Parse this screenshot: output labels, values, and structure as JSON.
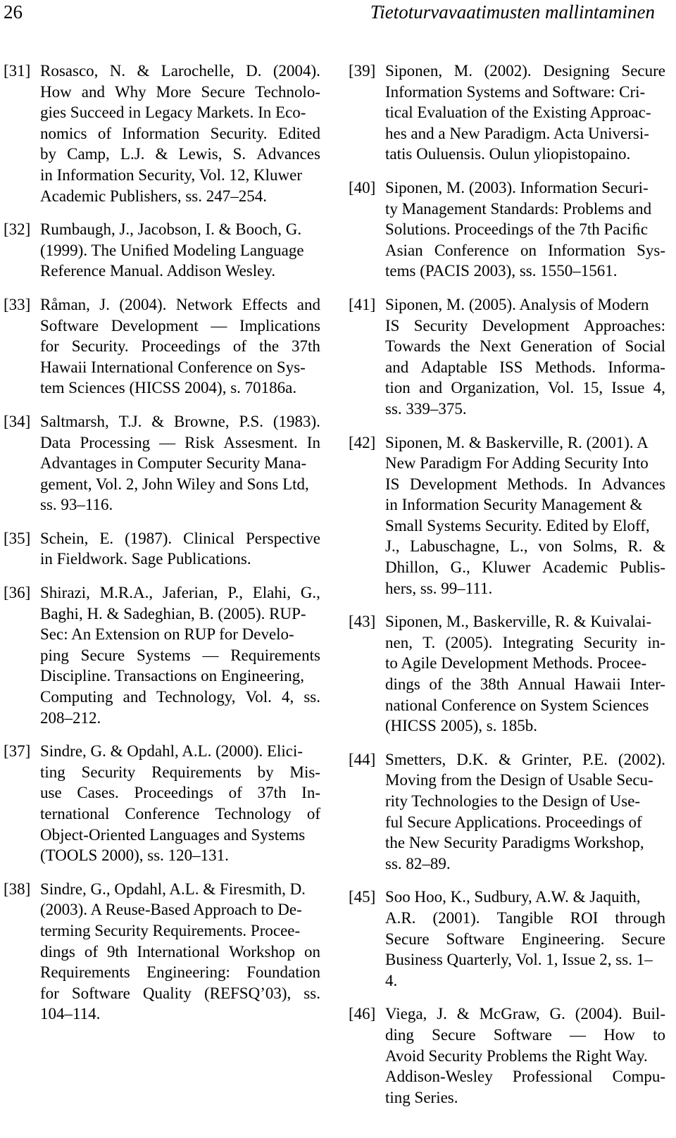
{
  "page": {
    "folio": "26",
    "running_title": "Tietoturvavaatimusten mallintaminen"
  },
  "columns": {
    "left": [
      {
        "label": "[31]",
        "text": "Rosasco, N. & Larochelle, D. (2004). How and Why More Secure Technologies Succeed in Legacy Markets. In Economics of Information Security. Edited by Camp, L.J. & Lewis, S. Advances in Information Security, Vol. 12, Kluwer Academic Publishers, ss. 247–254.",
        "lines": [
          [
            "Rosasco,",
            "N.",
            "&",
            "Larochelle,",
            "D.",
            "(2004)."
          ],
          [
            "How",
            "and",
            "Why",
            "More",
            "Secure",
            "Technolo-"
          ],
          [
            "gies Succeed in Legacy Markets. In Eco-"
          ],
          [
            "nomics",
            "of",
            "Information",
            "Security.",
            "Edited"
          ],
          [
            "by",
            "Camp,",
            "L.J.",
            "&",
            "Lewis,",
            "S.",
            "Advances"
          ],
          [
            "in Information Security, Vol. 12, Kluwer"
          ],
          [
            "Academic Publishers, ss. 247–254."
          ]
        ]
      },
      {
        "label": "[32]",
        "text": "Rumbaugh, J., Jacobson, I. & Booch, G. (1999). The Unified Modeling Language Reference Manual. Addison Wesley.",
        "lines": [
          [
            "Rumbaugh, J., Jacobson, I. & Booch, G."
          ],
          [
            "(1999). The Uniﬁed Modeling Language"
          ],
          [
            "Reference Manual. Addison Wesley."
          ]
        ]
      },
      {
        "label": "[33]",
        "text": "Råman, J. (2004). Network Effects and Software Development — Implications for Security. Proceedings of the 37th Hawaii International Conference on System Sciences (HICSS 2004), s. 70186a.",
        "lines": [
          [
            "Råman,",
            "J.",
            "(2004).",
            "Network",
            "Effects",
            "and"
          ],
          [
            "Software",
            "Development",
            "—",
            "Implications"
          ],
          [
            "for",
            "Security.",
            "Proceedings",
            "of",
            "the",
            "37th"
          ],
          [
            "Hawaii International Conference on Sys-"
          ],
          [
            "tem Sciences (HICSS 2004), s. 70186a."
          ]
        ]
      },
      {
        "label": "[34]",
        "text": "Saltmarsh, T.J. & Browne, P.S. (1983). Data Processing — Risk Assesment. In Advantages in Computer Security Management, Vol. 2, John Wiley and Sons Ltd, ss. 93–116.",
        "lines": [
          [
            "Saltmarsh,",
            "T.J.",
            "&",
            "Browne,",
            "P.S.",
            "(1983)."
          ],
          [
            "Data",
            "Processing",
            "—",
            "Risk",
            "Assesment.",
            "In"
          ],
          [
            "Advantages in Computer Security Mana-"
          ],
          [
            "gement, Vol. 2, John Wiley and Sons Ltd,"
          ],
          [
            "ss. 93–116."
          ]
        ]
      },
      {
        "label": "[35]",
        "text": "Schein, E. (1987). Clinical Perspective in Fieldwork. Sage Publications.",
        "lines": [
          [
            "Schein,",
            "E.",
            "(1987).",
            "Clinical",
            "Perspective"
          ],
          [
            "in Fieldwork. Sage Publications."
          ]
        ]
      },
      {
        "label": "[36]",
        "text": "Shirazi, M.R.A., Jaferian, P., Elahi, G., Baghi, H. & Sadeghian, B. (2005). RUPSec: An Extension on RUP for Developing Secure Systems — Requirements Discipline. Transactions on Engineering, Computing and Technology, Vol. 4, ss. 208–212.",
        "lines": [
          [
            "Shirazi,",
            "M.R.A.,",
            "Jaferian,",
            "P.,",
            "Elahi,",
            "G.,"
          ],
          [
            "Baghi, H. & Sadeghian, B. (2005). RUP-"
          ],
          [
            "Sec: An Extension on RUP for Develo-"
          ],
          [
            "ping",
            "Secure",
            "Systems",
            "—",
            "Requirements"
          ],
          [
            "Discipline. Transactions on Engineering,"
          ],
          [
            "Computing",
            "and",
            "Technology,",
            "Vol.",
            "4,",
            "ss."
          ],
          [
            "208–212."
          ]
        ]
      },
      {
        "label": "[37]",
        "text": "Sindre, G. & Opdahl, A.L. (2000). Eliciting Security Requirements by Misuse Cases. Proceedings of 37th International Conference Technology of Object-Oriented Languages and Systems (TOOLS 2000), ss. 120–131.",
        "lines": [
          [
            "Sindre, G. & Opdahl, A.L. (2000). Elici-"
          ],
          [
            "ting",
            "Security",
            "Requirements",
            "by",
            "Mis-"
          ],
          [
            "use",
            "Cases.",
            "Proceedings",
            "of",
            "37th",
            "In-"
          ],
          [
            "ternational",
            "Conference",
            "Technology",
            "of"
          ],
          [
            "Object-Oriented Languages and Systems"
          ],
          [
            "(TOOLS 2000), ss. 120–131."
          ]
        ]
      },
      {
        "label": "[38]",
        "text": "Sindre, G., Opdahl, A.L. & Firesmith, D. (2003). A Reuse-Based Approach to Determing Security Requirements. Proceedings of 9th International Workshop on Requirements Engineering: Foundation for Software Quality (REFSQ’03), ss. 104–114.",
        "lines": [
          [
            "Sindre, G., Opdahl, A.L. & Firesmith, D."
          ],
          [
            "(2003). A Reuse-Based Approach to De-"
          ],
          [
            "terming Security Requirements. Procee-"
          ],
          [
            "dings",
            "of",
            "9th",
            "International",
            "Workshop",
            "on"
          ],
          [
            "Requirements",
            "Engineering:",
            "Foundation"
          ],
          [
            "for",
            "Software",
            "Quality",
            "(REFSQ’03),",
            "ss."
          ],
          [
            "104–114."
          ]
        ]
      }
    ],
    "right": [
      {
        "label": "[39]",
        "text": "Siponen, M. (2002). Designing Secure Information Systems and Software: Critical Evaluation of the Existing Approaches and a New Paradigm. Acta Universitatis Ouluensis. Oulun yliopistopaino.",
        "lines": [
          [
            "Siponen,",
            "M.",
            "(2002).",
            "Designing",
            "Secure"
          ],
          [
            "Information Systems and Software: Cri-"
          ],
          [
            "tical Evaluation of the Existing Approac-"
          ],
          [
            "hes and a New Paradigm. Acta Universi-"
          ],
          [
            "tatis Ouluensis. Oulun yliopistopaino."
          ]
        ]
      },
      {
        "label": "[40]",
        "text": "Siponen, M. (2003). Information Security Management Standards: Problems and Solutions. Proceedings of the 7th Pacific Asian Conference on Information Systems (PACIS 2003), ss. 1550–1561.",
        "lines": [
          [
            "Siponen, M. (2003). Information Securi-"
          ],
          [
            "ty Management Standards: Problems and"
          ],
          [
            "Solutions. Proceedings of the 7th Paciﬁc"
          ],
          [
            "Asian",
            "Conference",
            "on",
            "Information",
            "Sys-"
          ],
          [
            "tems (PACIS 2003), ss. 1550–1561."
          ]
        ]
      },
      {
        "label": "[41]",
        "text": "Siponen, M. (2005). Analysis of Modern IS Security Development Approaches: Towards the Next Generation of Social and Adaptable ISS Methods. Information and Organization, Vol. 15, Issue 4, ss. 339–375.",
        "lines": [
          [
            "Siponen, M. (2005). Analysis of Modern"
          ],
          [
            "IS",
            "Security",
            "Development",
            "Approaches:"
          ],
          [
            "Towards",
            "the",
            "Next",
            "Generation",
            "of",
            "Social"
          ],
          [
            "and",
            "Adaptable",
            "ISS",
            "Methods.",
            "Informa-"
          ],
          [
            "tion",
            "and",
            "Organization,",
            "Vol.",
            "15,",
            "Issue",
            "4,"
          ],
          [
            "ss. 339–375."
          ]
        ]
      },
      {
        "label": "[42]",
        "text": "Siponen, M. & Baskerville, R. (2001). A New Paradigm For Adding Security Into IS Development Methods. In Advances in Information Security Management & Small Systems Security. Edited by Eloff, J., Labuschagne, L., von Solms, R. & Dhillon, G., Kluwer Academic Publishers, ss. 99–111.",
        "lines": [
          [
            "Siponen, M. & Baskerville, R. (2001). A"
          ],
          [
            "New Paradigm For Adding Security Into"
          ],
          [
            "IS",
            "Development",
            "Methods.",
            "In",
            "Advances"
          ],
          [
            "in Information Security Management &"
          ],
          [
            "Small Systems Security. Edited by Eloff,"
          ],
          [
            "J.,",
            "Labuschagne,",
            "L.,",
            "von",
            "Solms,",
            "R.",
            "&"
          ],
          [
            "Dhillon,",
            "G.,",
            "Kluwer",
            "Academic",
            "Publis-"
          ],
          [
            "hers, ss. 99–111."
          ]
        ]
      },
      {
        "label": "[43]",
        "text": "Siponen, M., Baskerville, R. & Kuivalainen, T. (2005). Integrating Security into Agile Development Methods. Proceedings of the 38th Annual Hawaii International Conference on System Sciences (HICSS 2005), s. 185b.",
        "lines": [
          [
            "Siponen, M., Baskerville, R. & Kuivalai-"
          ],
          [
            "nen,",
            "T.",
            "(2005).",
            "Integrating",
            "Security",
            "in-"
          ],
          [
            "to Agile Development Methods. Procee-"
          ],
          [
            "dings",
            "of",
            "the",
            "38th",
            "Annual",
            "Hawaii",
            "Inter-"
          ],
          [
            "national Conference on System Sciences"
          ],
          [
            "(HICSS 2005), s. 185b."
          ]
        ]
      },
      {
        "label": "[44]",
        "text": "Smetters, D.K. & Grinter, P.E. (2002). Moving from the Design of Usable Security Technologies to the Design of Useful Secure Applications. Proceedings of the New Security Paradigms Workshop, ss. 82–89.",
        "lines": [
          [
            "Smetters,",
            "D.K.",
            "&",
            "Grinter,",
            "P.E.",
            "(2002)."
          ],
          [
            "Moving from the Design of Usable Secu-"
          ],
          [
            "rity Technologies to the Design of Use-"
          ],
          [
            "ful Secure Applications. Proceedings of"
          ],
          [
            "the New Security Paradigms Workshop,"
          ],
          [
            "ss. 82–89."
          ]
        ]
      },
      {
        "label": "[45]",
        "text": "Soo Hoo, K., Sudbury, A.W. & Jaquith, A.R. (2001). Tangible ROI through Secure Software Engineering. Secure Business Quarterly, Vol. 1, Issue 2, ss. 1–4.",
        "lines": [
          [
            "Soo Hoo, K., Sudbury, A.W. & Jaquith,"
          ],
          [
            "A.R.",
            "(2001).",
            "Tangible",
            "ROI",
            "through"
          ],
          [
            "Secure",
            "Software",
            "Engineering.",
            "Secure"
          ],
          [
            "Business Quarterly, Vol. 1, Issue 2, ss. 1–"
          ],
          [
            "4."
          ]
        ]
      },
      {
        "label": "[46]",
        "text": "Viega, J. & McGraw, G. (2004). Building Secure Software — How to Avoid Security Problems the Right Way. Addison-Wesley Professional Computing Series.",
        "lines": [
          [
            "Viega,",
            "J.",
            "&",
            "McGraw,",
            "G.",
            "(2004).",
            "Buil-"
          ],
          [
            "ding",
            "Secure",
            "Software",
            "—",
            "How",
            "to"
          ],
          [
            "Avoid Security Problems the Right Way."
          ],
          [
            "Addison-Wesley",
            "Professional",
            "Compu-"
          ],
          [
            "ting Series."
          ]
        ]
      }
    ]
  }
}
